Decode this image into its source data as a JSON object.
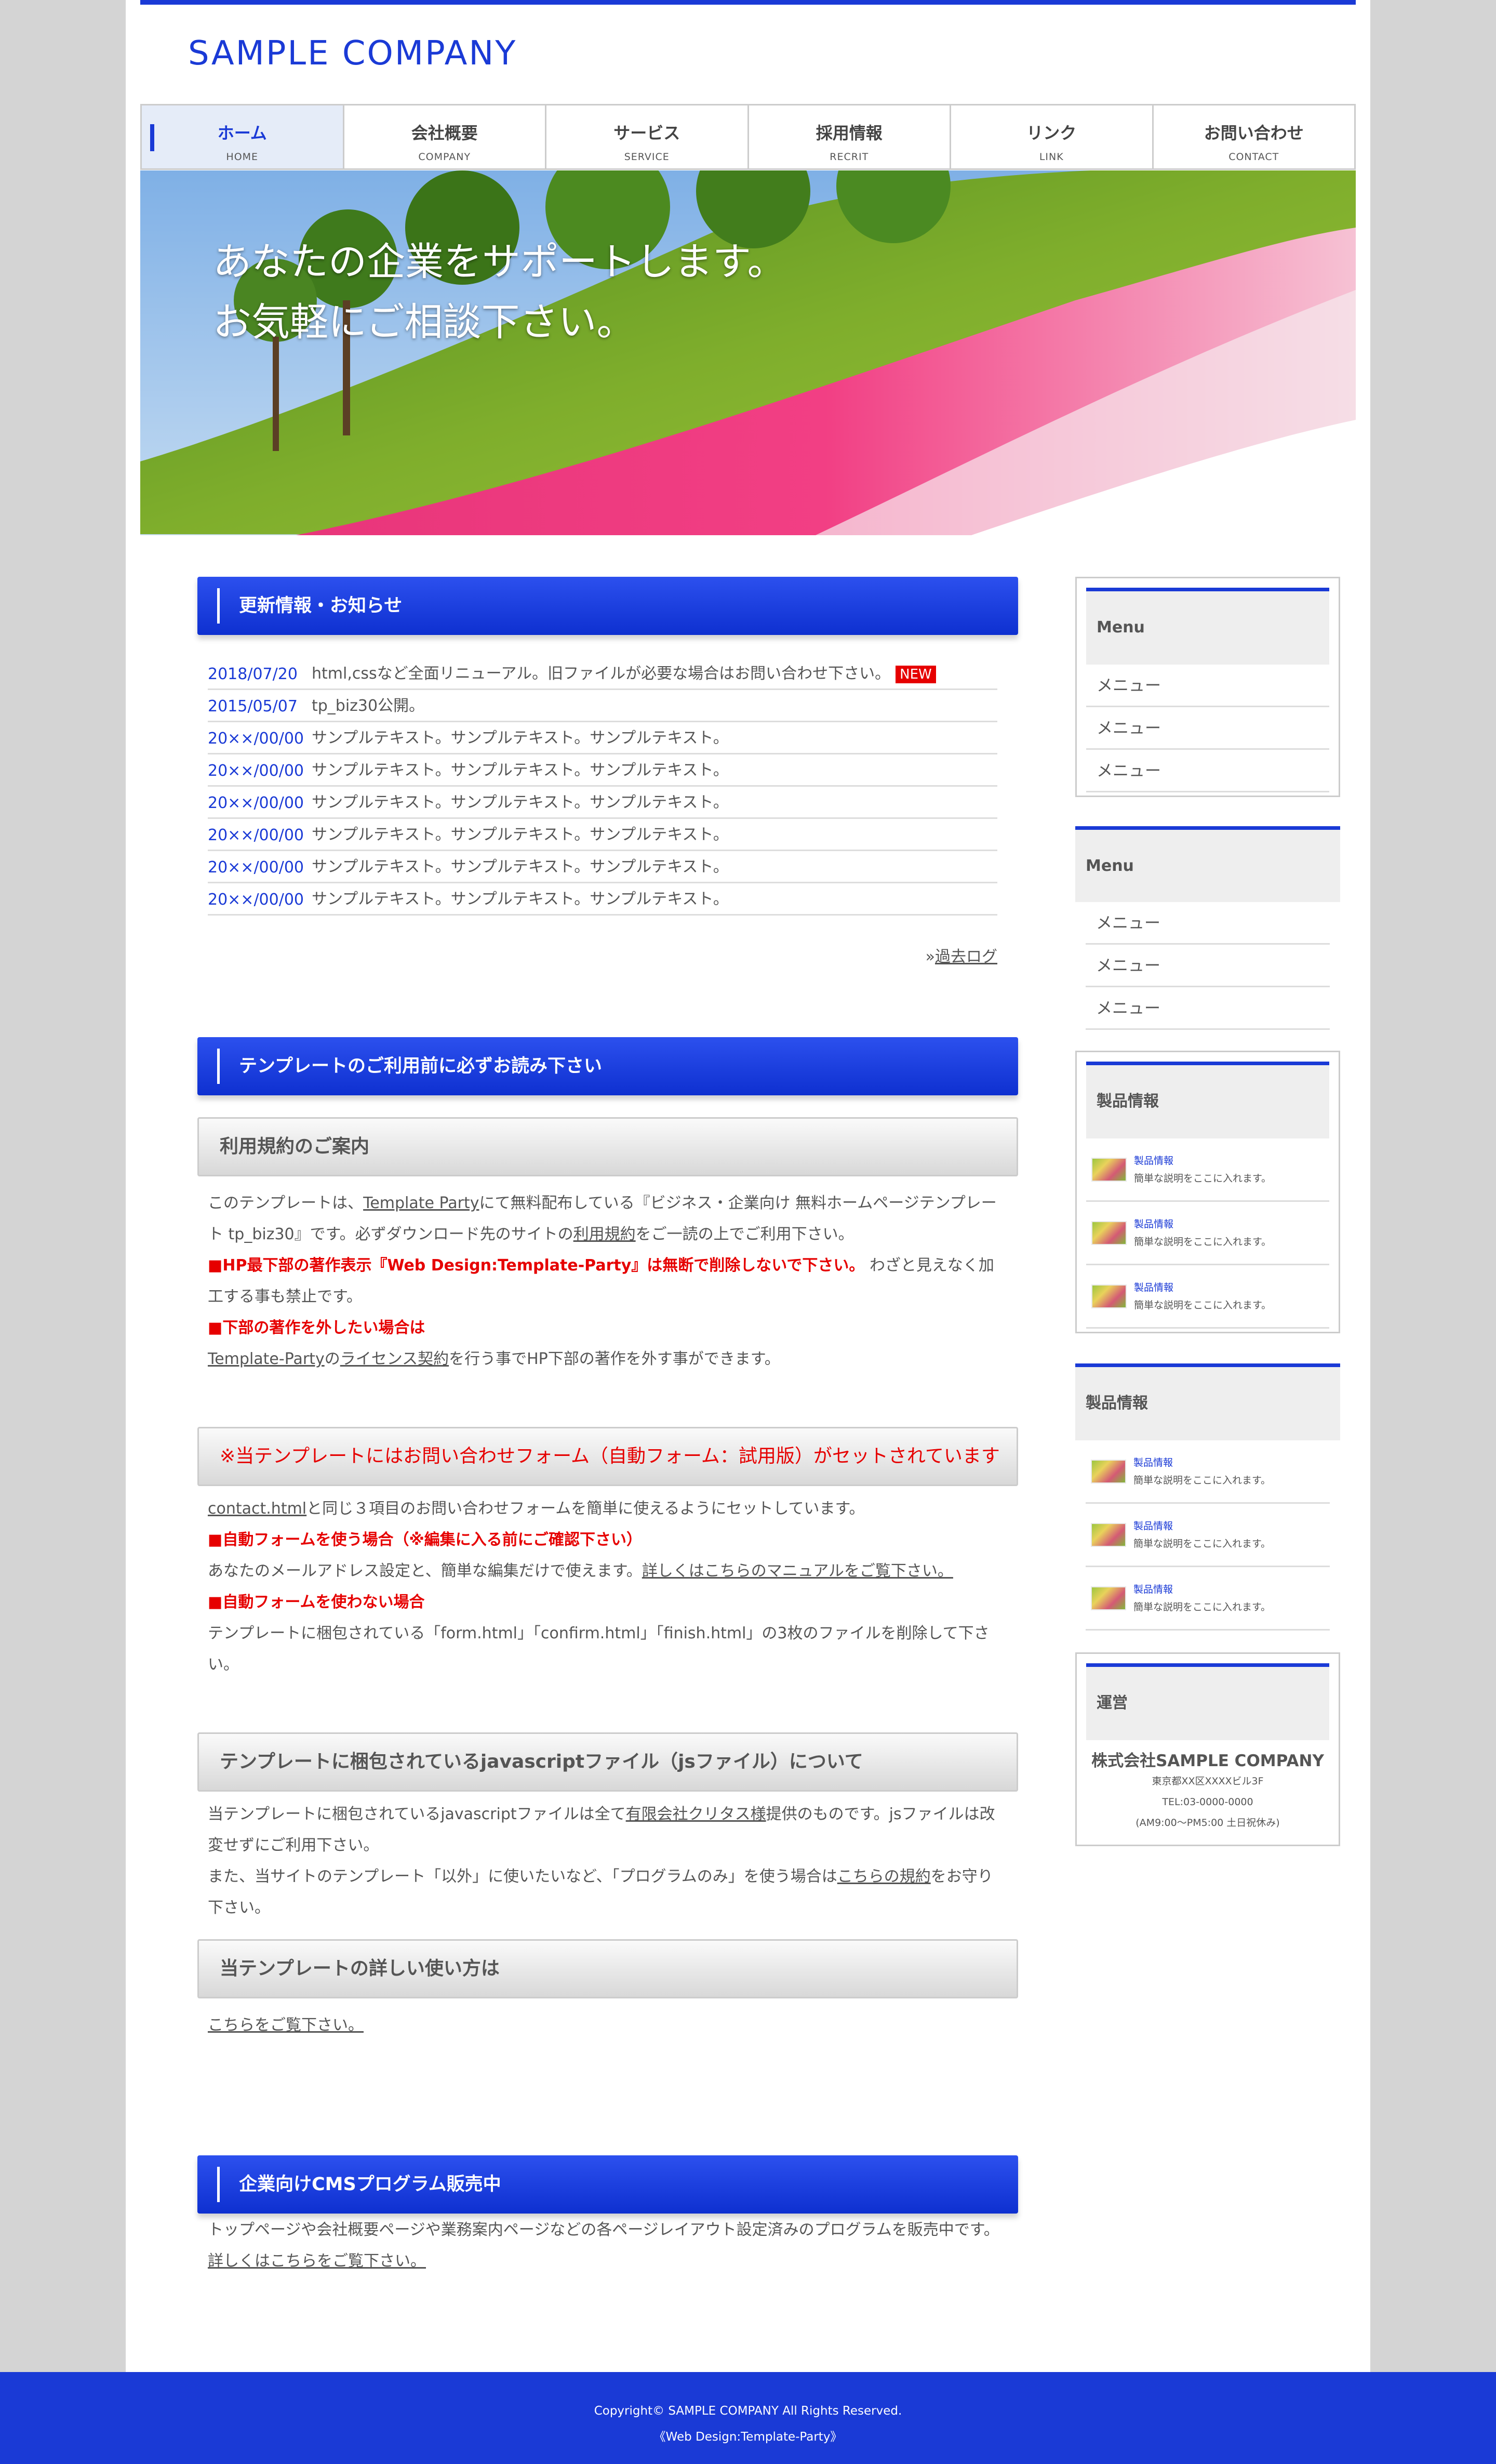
{
  "site": {
    "logo": "SAMPLE COMPANY"
  },
  "nav": [
    {
      "jp": "ホーム",
      "en": "HOME"
    },
    {
      "jp": "会社概要",
      "en": "COMPANY"
    },
    {
      "jp": "サービス",
      "en": "SERVICE"
    },
    {
      "jp": "採用情報",
      "en": "RECRIT"
    },
    {
      "jp": "リンク",
      "en": "LINK"
    },
    {
      "jp": "お問い合わせ",
      "en": "CONTACT"
    }
  ],
  "hero": {
    "line1": "あなたの企業をサポートします。",
    "line2": "お気軽にご相談下さい。"
  },
  "news": {
    "title": "更新情報・お知らせ",
    "items": [
      {
        "date": "2018/07/20",
        "text": "html,cssなど全面リニューアル。旧ファイルが必要な場合はお問い合わせ下さい。",
        "badge": "NEW"
      },
      {
        "date": "2015/05/07",
        "text": "tp_biz30公開。"
      },
      {
        "date": "20××/00/00",
        "text": "サンプルテキスト。サンプルテキスト。サンプルテキスト。"
      },
      {
        "date": "20××/00/00",
        "text": "サンプルテキスト。サンプルテキスト。サンプルテキスト。"
      },
      {
        "date": "20××/00/00",
        "text": "サンプルテキスト。サンプルテキスト。サンプルテキスト。"
      },
      {
        "date": "20××/00/00",
        "text": "サンプルテキスト。サンプルテキスト。サンプルテキスト。"
      },
      {
        "date": "20××/00/00",
        "text": "サンプルテキスト。サンプルテキスト。サンプルテキスト。"
      },
      {
        "date": "20××/00/00",
        "text": "サンプルテキスト。サンプルテキスト。サンプルテキスト。"
      }
    ],
    "archive_prefix": "»",
    "archive": "過去ログ"
  },
  "notice": {
    "title": "テンプレートのご利用前に必ずお読み下さい",
    "terms": {
      "title": "利用規約のご案内",
      "p1_a": "このテンプレートは、",
      "p1_link1": "Template Party",
      "p1_b": "にて無料配布している『ビジネス・企業向け 無料ホームページテンプレート tp_biz30』です。必ずダウンロード先のサイトの",
      "p1_link2": "利用規約",
      "p1_c": "をご一読の上でご利用下さい。",
      "p2_red": "■HP最下部の著作表示『Web Design:Template-Party』は無断で削除しないで下さい。",
      "p2_rest": "わざと見えなく加工する事も禁止です。",
      "p3_red": "■下部の著作を外したい場合は",
      "p4_link1": "Template-Party",
      "p4_a": "の",
      "p4_link2": "ライセンス契約",
      "p4_b": "を行う事でHP下部の著作を外す事ができます。"
    },
    "form": {
      "title": "※当テンプレートにはお問い合わせフォーム（自動フォーム：試用版）がセットされています",
      "p1_link": "contact.html",
      "p1_rest": "と同じ３項目のお問い合わせフォームを簡単に使えるようにセットしています。",
      "p2_red": "■自動フォームを使う場合（※編集に入る前にご確認下さい）",
      "p3_a": "あなたのメールアドレス設定と、簡単な編集だけで使えます。",
      "p3_link": "詳しくはこちらのマニュアルをご覧下さい。",
      "p4_red": "■自動フォームを使わない場合",
      "p5": "テンプレートに梱包されている「form.html」「confirm.html」「finish.html」の3枚のファイルを削除して下さい。"
    },
    "js": {
      "title": "テンプレートに梱包されているjavascriptファイル（jsファイル）について",
      "p1_a": "当テンプレートに梱包されているjavascriptファイルは全て",
      "p1_link": "有限会社クリタス様",
      "p1_b": "提供のものです。jsファイルは改変せずにご利用下さい。",
      "p2_a": "また、当サイトのテンプレート「以外」に使いたいなど、「プログラムのみ」を使う場合は",
      "p2_link": "こちらの規約",
      "p2_b": "をお守り下さい。"
    },
    "howto": {
      "title": "当テンプレートの詳しい使い方は",
      "link": "こちらをご覧下さい。"
    }
  },
  "cms": {
    "title": "企業向けCMSプログラム販売中",
    "text": "トップページや会社概要ページや業務案内ページなどの各ページレイアウト設定済みのプログラムを販売中です。",
    "link": "詳しくはこちらをご覧下さい。"
  },
  "sidebar": {
    "menu1": {
      "title": "Menu",
      "items": [
        "メニュー",
        "メニュー",
        "メニュー"
      ]
    },
    "menu2": {
      "title": "Menu",
      "items": [
        "メニュー",
        "メニュー",
        "メニュー"
      ]
    },
    "products1": {
      "title": "製品情報",
      "items": [
        {
          "name": "製品情報",
          "desc": "簡単な説明をここに入れます。"
        },
        {
          "name": "製品情報",
          "desc": "簡単な説明をここに入れます。"
        },
        {
          "name": "製品情報",
          "desc": "簡単な説明をここに入れます。"
        }
      ]
    },
    "products2": {
      "title": "製品情報",
      "items": [
        {
          "name": "製品情報",
          "desc": "簡単な説明をここに入れます。"
        },
        {
          "name": "製品情報",
          "desc": "簡単な説明をここに入れます。"
        },
        {
          "name": "製品情報",
          "desc": "簡単な説明をここに入れます。"
        }
      ]
    },
    "org": {
      "title": "運営",
      "name": "株式会社SAMPLE COMPANY",
      "address": "東京都XX区XXXXビル3F",
      "tel": "TEL:03-0000-0000",
      "hours": "(AM9:00〜PM5:00 土日祝休み)"
    }
  },
  "footer": {
    "copyright": "Copyright© SAMPLE COMPANY All Rights Reserved.",
    "credit": "《Web Design:Template-Party》"
  },
  "colors": {
    "accent": "#1a3ad6",
    "red": "#e60000",
    "page_bg": "#d4d4d4"
  }
}
